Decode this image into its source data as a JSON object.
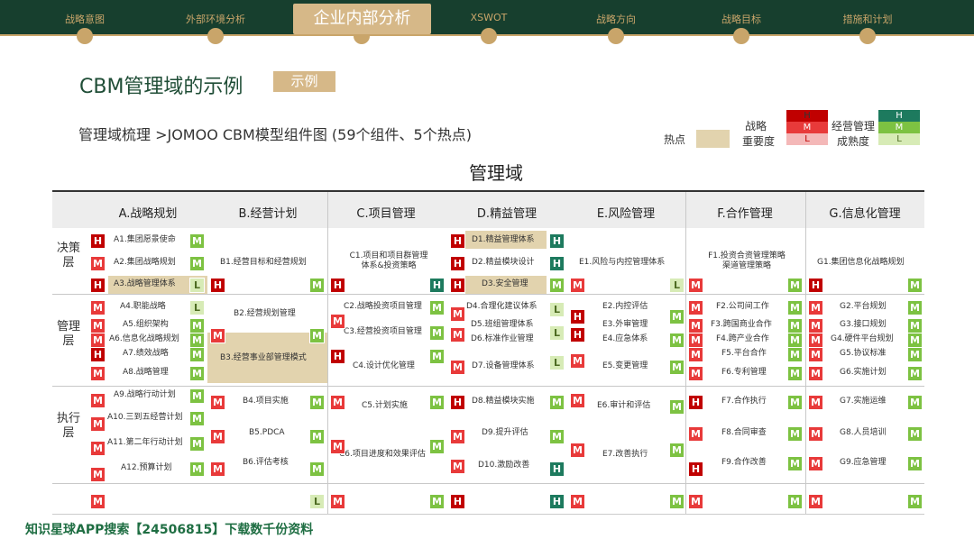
{
  "nav": {
    "items": [
      "战略意图",
      "外部环境分析",
      "企业内部分析",
      "XSWOT",
      "战略方向",
      "战略目标",
      "措施和计划"
    ],
    "active_index": 2
  },
  "header": {
    "title": "CBM管理域的示例",
    "badge": "示例",
    "subtitle": "管理域梳理 >JOMOO CBM模型组件图 (59个组件、5个热点)"
  },
  "legend": {
    "hot_label": "热点",
    "strategy_label_1": "战略",
    "strategy_label_2": "重要度",
    "maturity_label_1": "经营管理",
    "maturity_label_2": "成熟度",
    "H": "H",
    "M": "M",
    "L": "L"
  },
  "grid": {
    "title": "管理域",
    "columns": [
      "A.战略规划",
      "B.经营计划",
      "C.项目管理",
      "D.精益管理",
      "E.风险管理",
      "F.合作管理",
      "G.信息化管理"
    ],
    "layers": [
      "决策层",
      "管理层",
      "执行层"
    ]
  },
  "cells": {
    "a1": "A1.集团愿景使命",
    "a2": "A2.集团战略规划",
    "a3": "A3.战略管理体系",
    "a4": "A4.职能战略",
    "a5": "A5.组织架构",
    "a6": "A6.信息化战略规划",
    "a7": "A7.绩效战略",
    "a8": "A8.战略管理",
    "a9": "A9.战略行动计划",
    "a10": "A10.三到五经营计划",
    "a11": "A11.第二年行动计划",
    "a12": "A12.预算计划",
    "b1": "B1.经营目标和经营规划",
    "b2": "B2.经营规划管理",
    "b3": "B3.经营事业部管理模式",
    "b4": "B4.项目实施",
    "b5": "B5.PDCA",
    "b6": "B6.评估考核",
    "c1a": "C1.项目和项目群管理",
    "c1b": "体系&投资策略",
    "c2": "C2.战略投资项目管理",
    "c3": "C3.经营投资项目管理",
    "c4": "C4.设计优化管理",
    "c5": "C5.计划实施",
    "c6": "C6.项目进度和效果评估",
    "d1": "D1.精益管理体系",
    "d2": "D2.精益模块设计",
    "d3": "D3.安全管理",
    "d4": "D4.合理化建议体系",
    "d5": "D5.班组管理体系",
    "d6": "D6.标准作业管理",
    "d7": "D7.设备管理体系",
    "d8": "D8.精益模块实施",
    "d9": "D9.提升评估",
    "d10": "D10.激励改善",
    "e1": "E1.风险与内控管理体系",
    "e2": "E2.内控评估",
    "e3": "E3.外审管理",
    "e4": "E4.应急体系",
    "e5": "E5.变更管理",
    "e6": "E6.审计和评估",
    "e7": "E7.改善执行",
    "f1a": "F1.投资合资管理策略",
    "f1b": "渠道管理策略",
    "f2": "F2.公司间工作",
    "f3": "F3.跨国商业合作",
    "f4": "F4.跨产业合作",
    "f5": "F5.平台合作",
    "f6": "F6.专利管理",
    "f7": "F7.合作执行",
    "f8": "F8.合同审查",
    "f9": "F9.合作改善",
    "g1": "G1.集团信息化战略规划",
    "g2": "G2.平台规划",
    "g3": "G3.接口规划",
    "g4": "G4.硬件平台规划",
    "g5": "G5.协议标准",
    "g6": "G6.实施计划",
    "g7": "G7.实施运维",
    "g8": "G8.人员培训",
    "g9": "G9.应急管理"
  },
  "footer": "知识星球APP搜索【24506815】下载数千份资料",
  "colors": {
    "accent": "#173f2e",
    "gold": "#d6b888",
    "hot": "#e2d3ae",
    "high": "#c00000",
    "mid": "#e83a3a",
    "green": "#7dc242",
    "green_dark": "#1d7a5e"
  }
}
